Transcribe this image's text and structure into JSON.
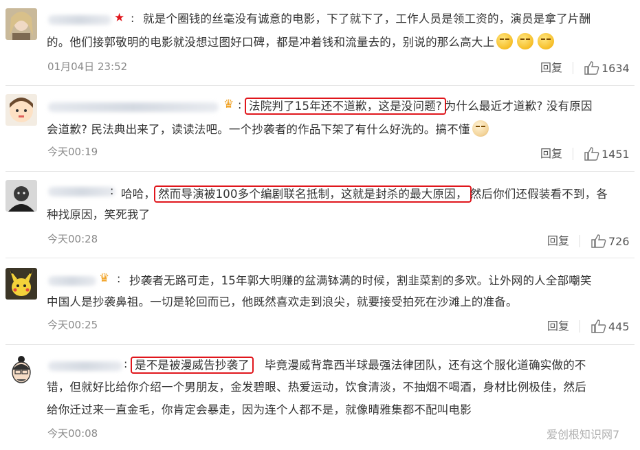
{
  "comments": [
    {
      "line1": "就是个圈钱的丝毫没有诚意的电影，下了就下了，工作人员是领工资的，演员是拿了片酬",
      "line2": "的。他们接郭敬明的电影就没想过图好口碑，都是冲着钱和流量去的，别说的那么高大上",
      "time": "01月04日 23:52",
      "reply": "回复",
      "likes": "1634"
    },
    {
      "highlight": "法院判了15年还不道歉，这是没问题?",
      "line1_rest": "为什么最近才道歉? 没有原因",
      "line2": "会道歉? 民法典出来了，读读法吧。一个抄袭者的作品下架了有什么好洗的。搞不懂",
      "time": "今天00:19",
      "reply": "回复",
      "likes": "1451"
    },
    {
      "prefix": "哈哈，",
      "highlight": "然而导演被100多个编剧联名抵制，这就是封杀的最大原因，",
      "line1_rest": "然后你们还假装看不到，各",
      "line2": "种找原因，笑死我了",
      "time": "今天00:28",
      "reply": "回复",
      "likes": "726"
    },
    {
      "line1": "抄袭者无路可走，15年郭大明赚的盆满钵满的时候，割韭菜割的多欢。让外网的人全部嘲笑",
      "line2": "中国人是抄袭鼻祖。一切是轮回而已，他既然喜欢走到浪尖，就要接受拍死在沙滩上的准备。",
      "time": "今天00:25",
      "reply": "回复",
      "likes": "445"
    },
    {
      "highlight": "是不是被漫威告抄袭了",
      "line1_rest": "毕竟漫威背靠西半球最强法律团队，还有这个服化道确实做的不",
      "line2": "错，但就好比给你介绍一个男朋友，金发碧眼、热爱运动，饮食清淡，不抽烟不喝酒，身材比例极佳，然后",
      "line3": "给你迁过来一直金毛，你肯定会暴走，因为连个人都不是，就像晴雅集都不配叫电影",
      "time": "今天00:08"
    }
  ],
  "colon": ":",
  "watermark": "爱创根知识网7",
  "colors": {
    "highlight": "#e0161c",
    "meta": "#8a8a8a"
  }
}
